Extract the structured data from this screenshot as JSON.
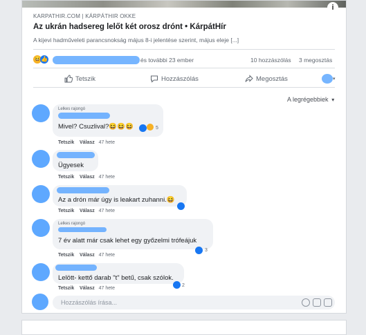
{
  "post": {
    "info_symbol": "i",
    "source": "KARPATHIR.COM | KÁRPÁTHIR OKKE",
    "headline": "Az ukrán hadsereg lelőt két orosz drónt • KárpátHír",
    "excerpt": "A kijevi hadműveleti parancsnokság május 8-i jelentése szerint, május eleje [...]",
    "reactions_summary": "és további 23 ember",
    "comments_count": "10 hozzászólás",
    "shares_count": "3 megosztás",
    "actions": {
      "like": "Tetszik",
      "comment": "Hozzászólás",
      "share": "Megosztás"
    },
    "sort_label": "A legrégebbiek",
    "icons": [
      "haha-icon",
      "like-icon",
      "thumb-up-icon",
      "comment-icon",
      "share-icon",
      "chevron-down-icon"
    ]
  },
  "comments": [
    {
      "badge": "Lelkes rajongó",
      "text": "Mivel? Csuzlival?😆😆😆",
      "like": "Tetszik",
      "reply": "Válasz",
      "time": "47 hete",
      "reaction_count": "5"
    },
    {
      "text": "Ügyesek",
      "like": "Tetszik",
      "reply": "Válasz",
      "time": "47 hete"
    },
    {
      "text": "Az a drón már úgy is leakart zuhanni.😆",
      "like": "Tetszik",
      "reply": "Válasz",
      "time": "47 hete"
    },
    {
      "badge": "Lelkes rajongó",
      "text": "7 év alatt már csak lehet egy győzelmi trófeájuk",
      "like": "Tetszik",
      "reply": "Válasz",
      "time": "47 hete",
      "reaction_count": "3"
    },
    {
      "text": "Lelött- kettő darab \"t\" betű, csak szólok.",
      "like": "Tetszik",
      "reply": "Válasz",
      "time": "47 hete",
      "reaction_count": "2"
    }
  ],
  "composer": {
    "placeholder": "Hozzászólás írása..."
  },
  "colors": {
    "accent": "#1877f2",
    "redaction": "#5ea8ff",
    "bubble": "#f0f2f5",
    "page_bg": "#e9ebee"
  }
}
